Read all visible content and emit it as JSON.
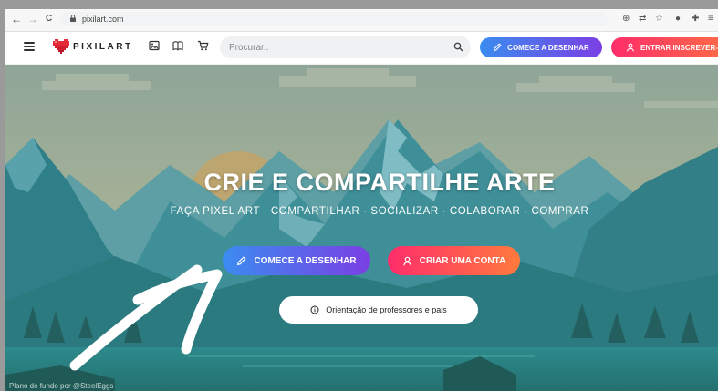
{
  "browser": {
    "url": "pixilart.com",
    "back_icon": "←",
    "forward_icon": "→",
    "reload_icon": "C"
  },
  "header": {
    "logo_text": "PIXILART",
    "search_placeholder": "Procurar..",
    "draw_button": "COMECE A DESENHAR",
    "enter_button": "ENTRAR INSCREVER-SE"
  },
  "hero": {
    "title": "CRIE E COMPARTILHE ARTE",
    "subtitle": "FAÇA PIXEL ART · COMPARTILHAR · SOCIALIZAR · COLABORAR · COMPRAR",
    "draw_button": "COMECE A DESENHAR",
    "account_button": "CRIAR UMA CONTA",
    "guide_button": "Orientação de professores e pais",
    "credit": "Plano de fundo por @SteelEggs"
  },
  "colors": {
    "brand_blue": "#3b8cf0",
    "brand_purple": "#7b3fe4",
    "brand_pink": "#ff2d6b",
    "brand_orange": "#ff7a3d",
    "hero_teal": "#2f8a93"
  }
}
